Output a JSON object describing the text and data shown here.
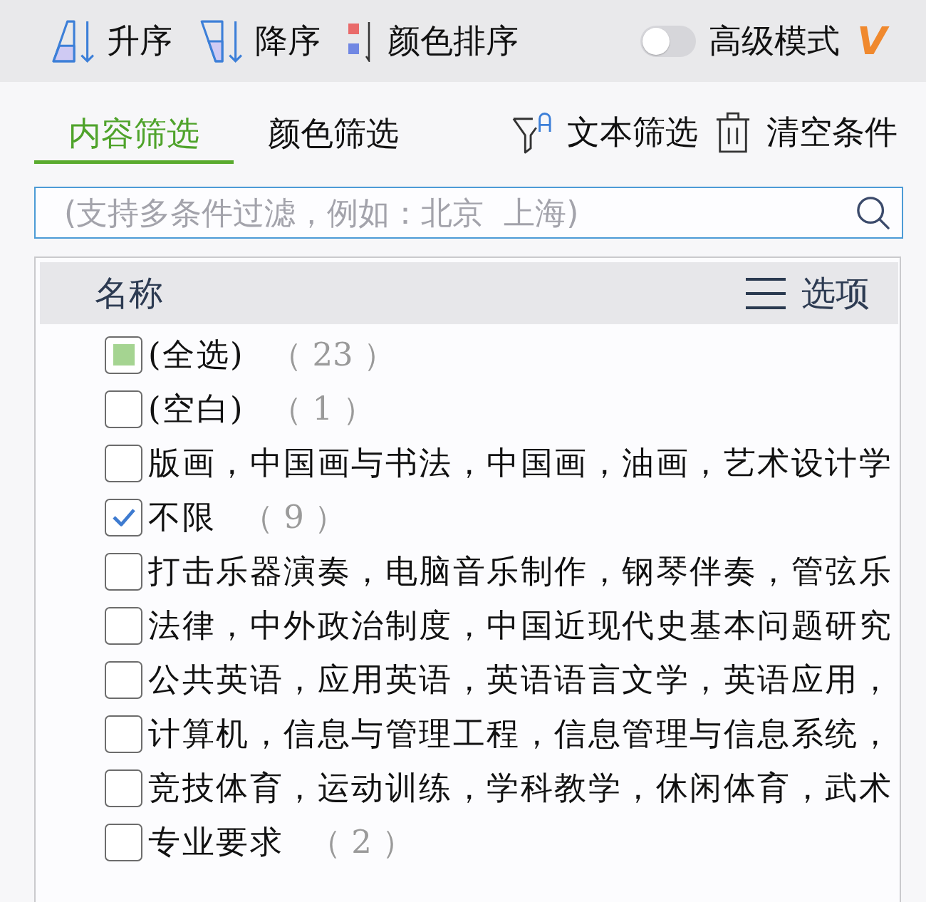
{
  "toolbar": {
    "buttons": [
      {
        "kind": "sort-ascending",
        "label": "升序"
      },
      {
        "kind": "sort-descending",
        "label": "降序"
      },
      {
        "kind": "color-sort",
        "label": "颜色排序"
      }
    ],
    "advanced_mode": {
      "label": "高级模式",
      "on": false
    },
    "badge": "V"
  },
  "tabs": [
    {
      "label": "内容筛选",
      "selected": true
    },
    {
      "label": "颜色筛选",
      "selected": false
    }
  ],
  "actions": [
    {
      "kind": "text-filter",
      "label": "文本筛选"
    },
    {
      "kind": "clear",
      "label": "清空条件"
    }
  ],
  "search": {
    "placeholder": "(支持多条件过滤，例如：北京  上海)"
  },
  "list": {
    "header": {
      "title": "名称",
      "options": "选项"
    },
    "items": [
      {
        "label": "(全选)",
        "count": "（ 23 ）",
        "checked": false,
        "indeterminate": true
      },
      {
        "label": "(空白)",
        "count": "（ 1 ）",
        "checked": false,
        "indeterminate": false
      },
      {
        "label": "版画，中国画与书法，中国画，油画，艺术设计学",
        "checked": false,
        "indeterminate": false
      },
      {
        "label": "不限",
        "count": "（ 9 ）",
        "checked": true,
        "indeterminate": false
      },
      {
        "label": "打击乐器演奏，电脑音乐制作，钢琴伴奏，管弦乐",
        "checked": false,
        "indeterminate": false
      },
      {
        "label": "法律，中外政治制度，中国近现代史基本问题研究",
        "checked": false,
        "indeterminate": false
      },
      {
        "label": "公共英语，应用英语，英语语言文学，英语应用，",
        "checked": false,
        "indeterminate": false
      },
      {
        "label": "计算机，信息与管理工程，信息管理与信息系统，",
        "checked": false,
        "indeterminate": false
      },
      {
        "label": "竞技体育，运动训练，学科教学，休闲体育，武术",
        "checked": false,
        "indeterminate": false
      },
      {
        "label": "专业要求",
        "count": "（ 2 ）",
        "checked": false,
        "indeterminate": false
      }
    ]
  }
}
